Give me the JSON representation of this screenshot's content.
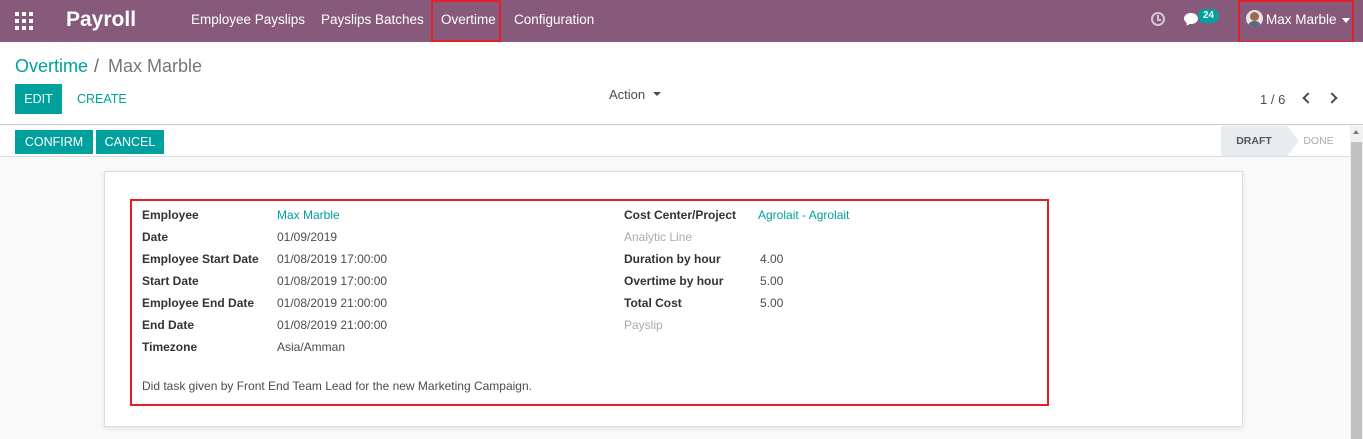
{
  "nav": {
    "brand": "Payroll",
    "menu": [
      "Employee Payslips",
      "Payslips Batches",
      "Overtime",
      "Configuration"
    ],
    "message_count": "24",
    "user_name": "Max Marble"
  },
  "breadcrumb": {
    "parent": "Overtime",
    "separator": "/",
    "current": "Max Marble"
  },
  "buttons": {
    "edit": "EDIT",
    "create": "CREATE",
    "action": "Action",
    "confirm": "CONFIRM",
    "cancel": "CANCEL"
  },
  "pager": {
    "value": "1 / 6"
  },
  "stages": {
    "draft": "DRAFT",
    "done": "DONE",
    "active": "DRAFT"
  },
  "form": {
    "left": [
      {
        "label": "Employee",
        "value": "Max Marble",
        "link": true
      },
      {
        "label": "Date",
        "value": "01/09/2019"
      },
      {
        "label": "Employee Start Date",
        "value": "01/08/2019 17:00:00"
      },
      {
        "label": "Start Date",
        "value": "01/08/2019 17:00:00"
      },
      {
        "label": "Employee End Date",
        "value": "01/08/2019 21:00:00"
      },
      {
        "label": "End Date",
        "value": "01/08/2019 21:00:00"
      },
      {
        "label": "Timezone",
        "value": "Asia/Amman"
      }
    ],
    "right": [
      {
        "label": "Cost Center/Project",
        "value": "Agrolait - Agrolait",
        "link": true
      },
      {
        "label": "Analytic Line",
        "value": ""
      },
      {
        "label": "Duration by hour",
        "value": "4.00"
      },
      {
        "label": "Overtime by hour",
        "value": "5.00"
      },
      {
        "label": "Total Cost",
        "value": "5.00"
      },
      {
        "label": "Payslip",
        "value": ""
      }
    ],
    "description": "Did task given by Front End Team Lead for the new Marketing Campaign."
  },
  "colors": {
    "nav_bg": "#875a7b",
    "accent": "#00a09d",
    "highlight": "#e31e24"
  },
  "icons": [
    "apps-grid-icon",
    "clock-icon",
    "chat-icon",
    "avatar",
    "caret-down-icon",
    "chevron-left-icon",
    "chevron-right-icon"
  ]
}
